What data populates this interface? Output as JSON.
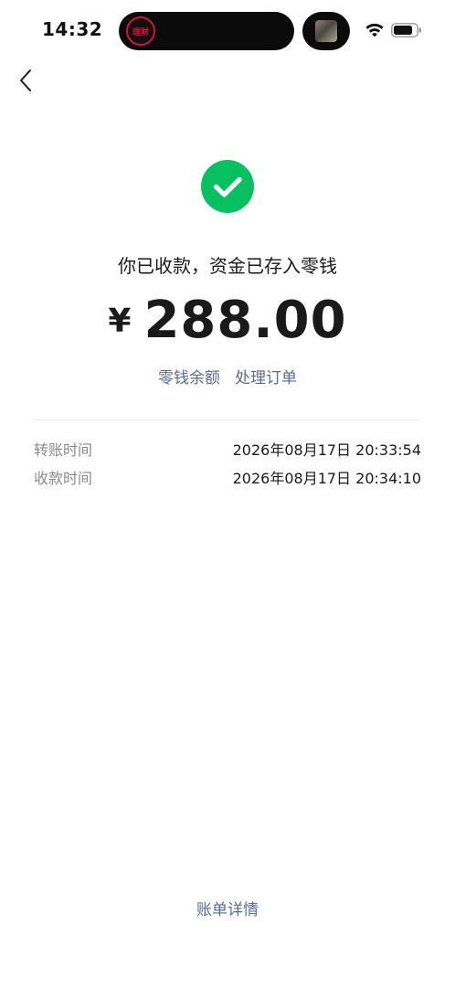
{
  "status_bar": {
    "time": "14:32",
    "island_app_text": "理财",
    "wifi_icon": "wifi-icon",
    "battery_icon": "battery-icon"
  },
  "nav": {
    "back_icon": "chevron-left-icon"
  },
  "result": {
    "icon": "success-check-icon",
    "accent_color": "#07c160",
    "message": "你已收款，资金已存入零钱",
    "currency_symbol": "¥",
    "amount": "288.00"
  },
  "links": {
    "balance": "零钱余额",
    "process_order": "处理订单",
    "link_color": "#576b95"
  },
  "details": [
    {
      "label": "转账时间",
      "value": "2026年08月17日 20:33:54"
    },
    {
      "label": "收款时间",
      "value": "2026年08月17日 20:34:10"
    }
  ],
  "footer": {
    "bill_detail": "账单详情"
  }
}
